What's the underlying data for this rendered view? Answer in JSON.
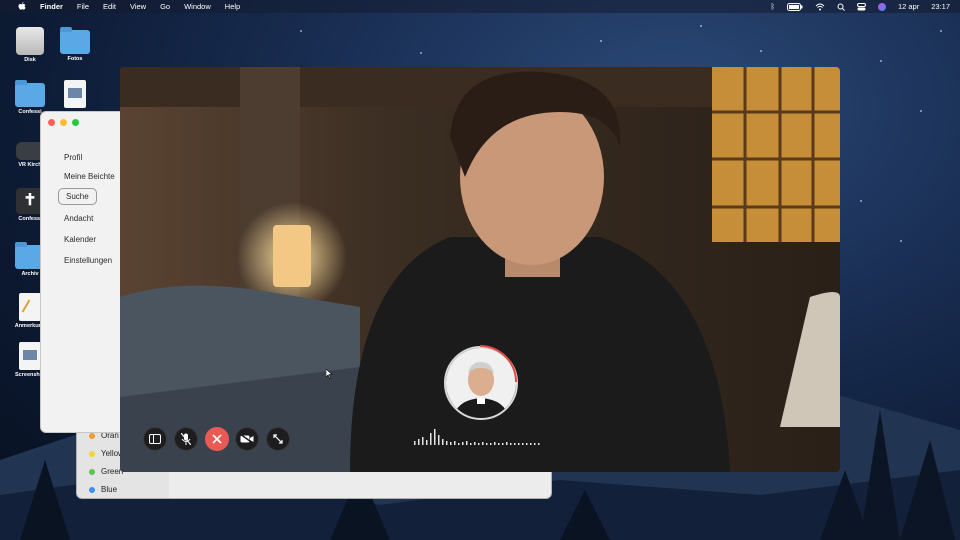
{
  "menubar": {
    "app": "Finder",
    "items": [
      "File",
      "Edit",
      "View",
      "Go",
      "Window",
      "Help"
    ],
    "date": "12 apr",
    "time": "23:17"
  },
  "desktop_icons": [
    {
      "label": "Disk",
      "icon": "disk-icon"
    },
    {
      "label": "Fotos",
      "icon": "folder-icon"
    },
    {
      "label": "Confessi",
      "icon": "folder-icon"
    },
    {
      "label": "",
      "icon": "image-file-icon"
    },
    {
      "label": "VR Kirch",
      "icon": "vr-headset-icon"
    },
    {
      "label": "Confessi",
      "icon": "cross-app-icon"
    },
    {
      "label": "Archiv",
      "icon": "folder-icon"
    },
    {
      "label": "Anmerkung",
      "icon": "document-icon"
    },
    {
      "label": "Screenshot",
      "icon": "image-file-icon"
    }
  ],
  "sidebar": {
    "items": [
      {
        "label": "Profil"
      },
      {
        "label": "Meine Beichte"
      },
      {
        "label": "Suche"
      },
      {
        "label": "Andacht"
      },
      {
        "label": "Kalender"
      },
      {
        "label": "Einstellungen"
      }
    ],
    "selected": "Suche"
  },
  "finder_tags": [
    {
      "label": "Oran",
      "color": "#f19a37"
    },
    {
      "label": "Yellow",
      "color": "#f5d33b"
    },
    {
      "label": "Green",
      "color": "#5ac451"
    },
    {
      "label": "Blue",
      "color": "#3a8ef6"
    }
  ],
  "call_controls": [
    {
      "name": "sidebar-toggle-icon"
    },
    {
      "name": "mute-microphone-icon"
    },
    {
      "name": "end-call-icon",
      "color": "#ea5a54"
    },
    {
      "name": "video-off-icon"
    },
    {
      "name": "fullscreen-icon"
    }
  ],
  "colors": {
    "end_call": "#ea5a54",
    "traffic_close": "#fe5f57",
    "traffic_min": "#febc2e",
    "traffic_max": "#28c840"
  }
}
